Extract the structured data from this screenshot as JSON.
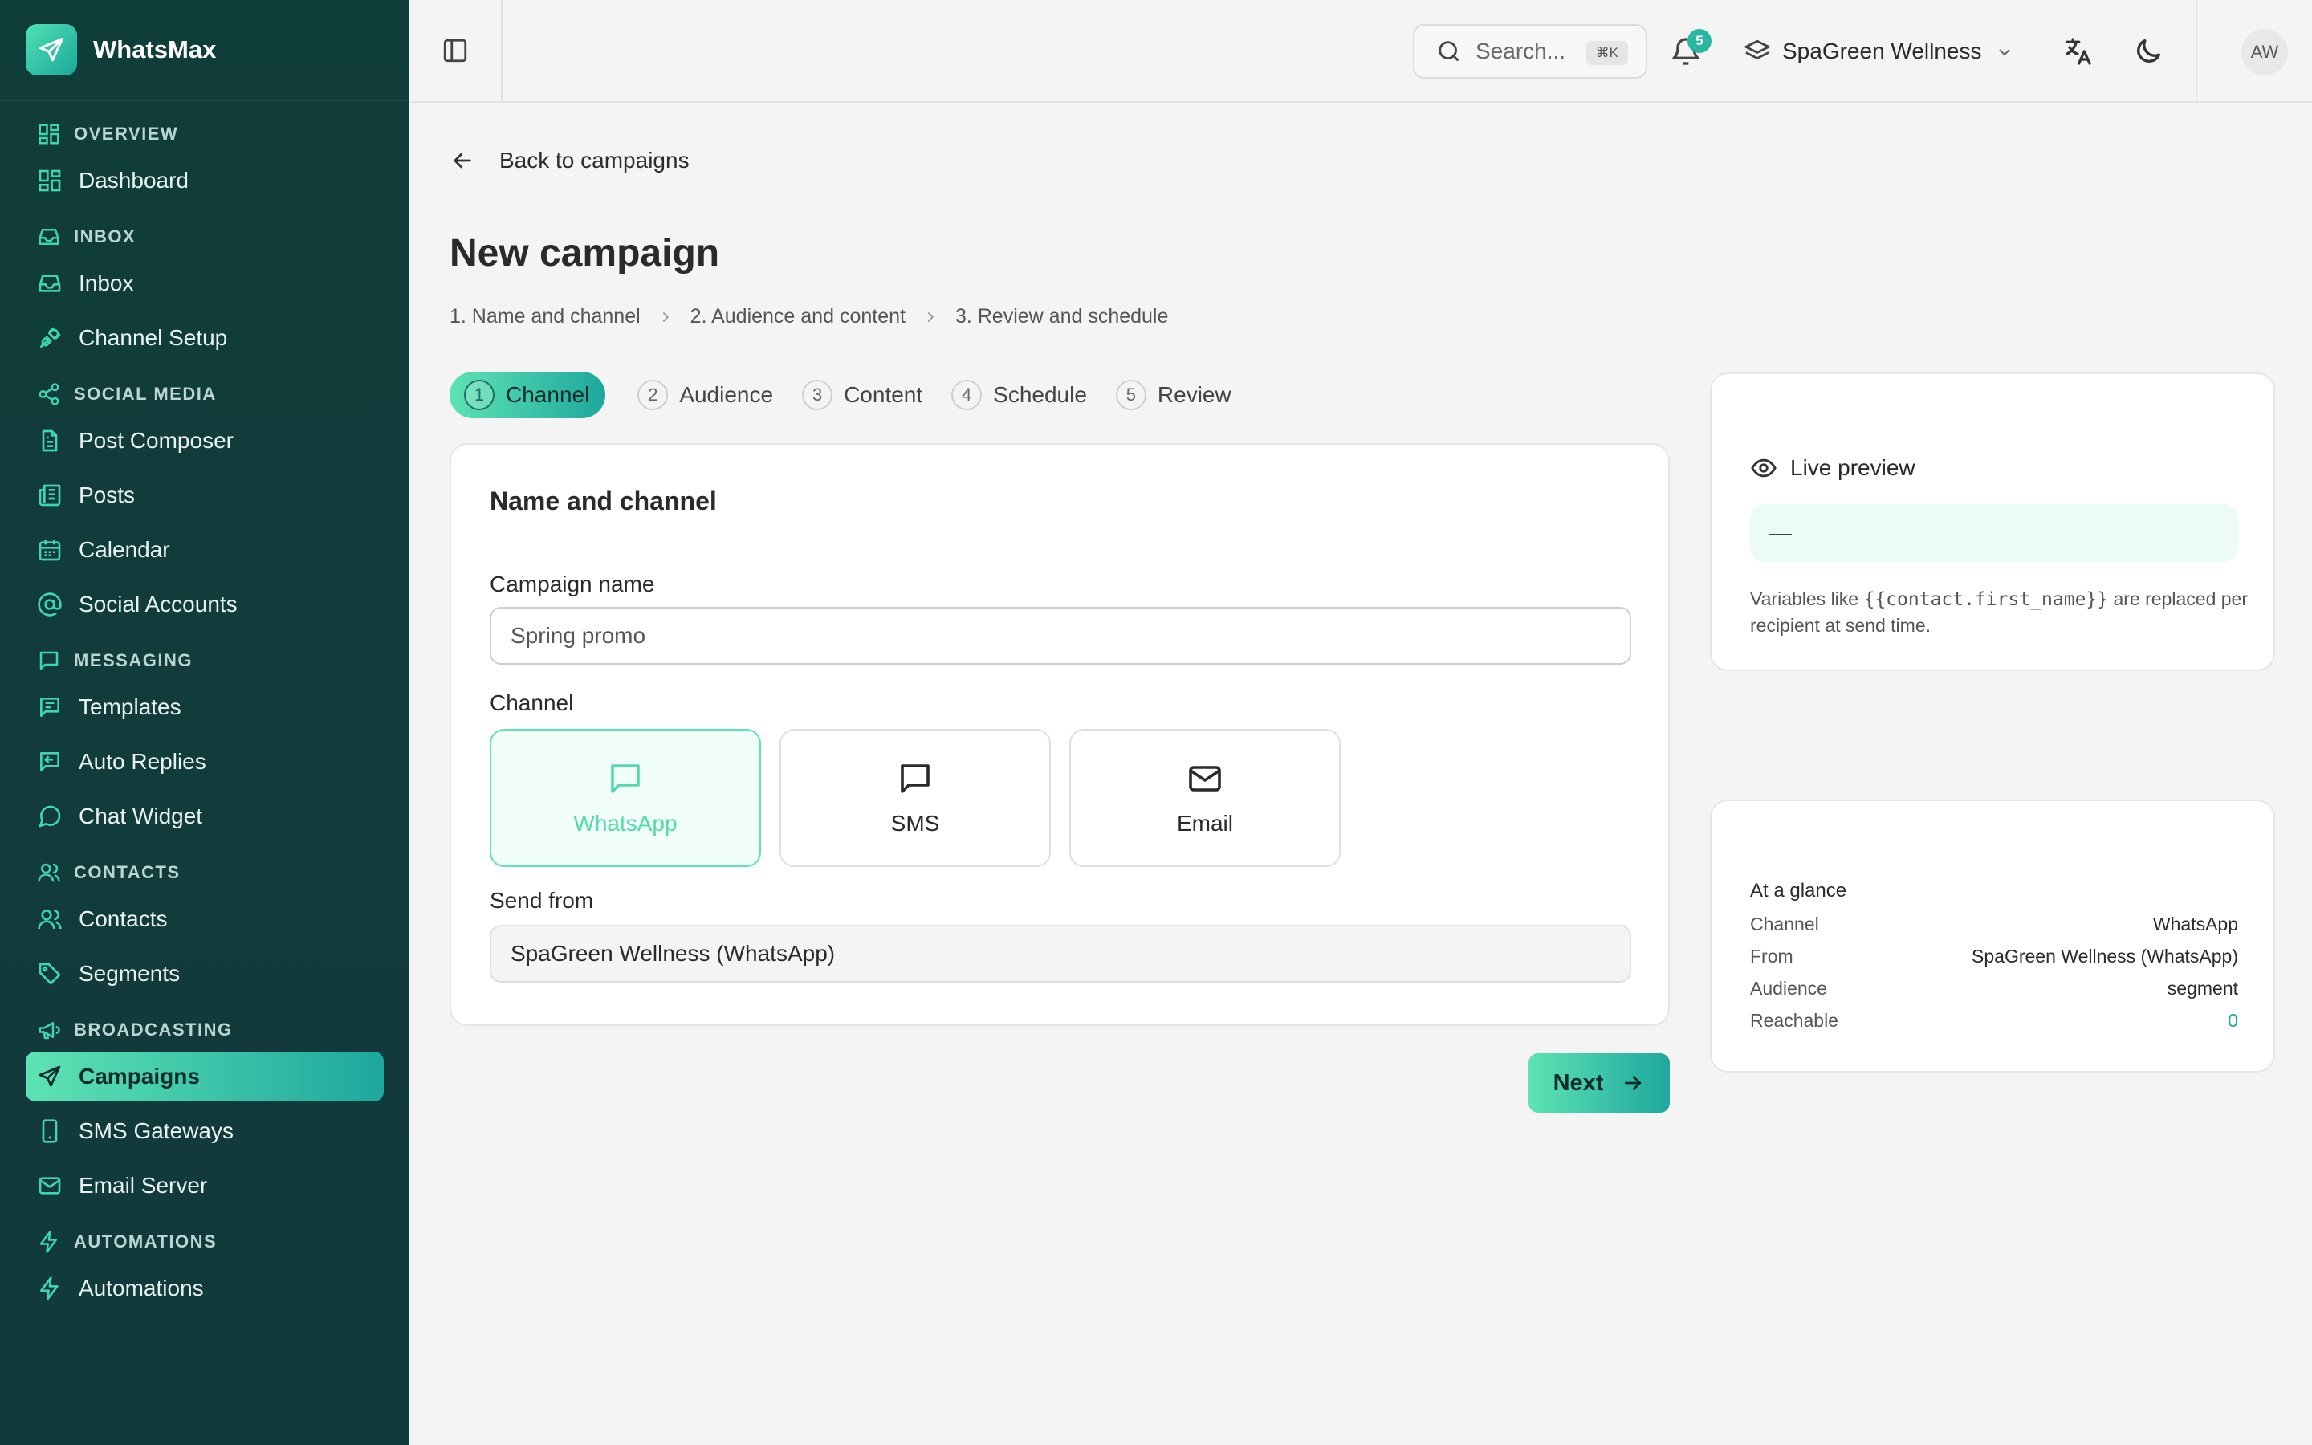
{
  "app": {
    "name": "WhatsMax"
  },
  "sidebar": {
    "sections": [
      {
        "title": "OVERVIEW",
        "items": [
          {
            "label": "Dashboard"
          }
        ]
      },
      {
        "title": "INBOX",
        "items": [
          {
            "label": "Inbox"
          },
          {
            "label": "Channel Setup"
          }
        ]
      },
      {
        "title": "SOCIAL MEDIA",
        "items": [
          {
            "label": "Post Composer"
          },
          {
            "label": "Posts"
          },
          {
            "label": "Calendar"
          },
          {
            "label": "Social Accounts"
          }
        ]
      },
      {
        "title": "MESSAGING",
        "items": [
          {
            "label": "Templates"
          },
          {
            "label": "Auto Replies"
          },
          {
            "label": "Chat Widget"
          }
        ]
      },
      {
        "title": "CONTACTS",
        "items": [
          {
            "label": "Contacts"
          },
          {
            "label": "Segments"
          }
        ]
      },
      {
        "title": "BROADCASTING",
        "items": [
          {
            "label": "Campaigns"
          },
          {
            "label": "SMS Gateways"
          },
          {
            "label": "Email Server"
          }
        ]
      },
      {
        "title": "AUTOMATIONS",
        "items": [
          {
            "label": "Automations"
          }
        ]
      }
    ],
    "active_item": "Campaigns"
  },
  "topbar": {
    "search_placeholder": "Search...",
    "search_shortcut": "⌘K",
    "notification_count": "5",
    "workspace": "SpaGreen Wellness",
    "avatar_initials": "AW"
  },
  "page": {
    "back_label": "Back to campaigns",
    "title": "New campaign",
    "breadcrumbs": [
      "1.  Name and channel",
      "2.  Audience and content",
      "3.  Review and schedule"
    ],
    "steps": [
      {
        "num": "1",
        "label": "Channel"
      },
      {
        "num": "2",
        "label": "Audience"
      },
      {
        "num": "3",
        "label": "Content"
      },
      {
        "num": "4",
        "label": "Schedule"
      },
      {
        "num": "5",
        "label": "Review"
      }
    ],
    "active_step": 1
  },
  "form": {
    "heading": "Name and channel",
    "campaign_name_label": "Campaign name",
    "campaign_name_placeholder": "Spring promo",
    "channel_label": "Channel",
    "channels": [
      {
        "label": "WhatsApp",
        "icon": "chat-bubble-icon"
      },
      {
        "label": "SMS",
        "icon": "message-square-icon"
      },
      {
        "label": "Email",
        "icon": "mail-icon"
      }
    ],
    "selected_channel": "WhatsApp",
    "send_from_label": "Send from",
    "send_from_value": "SpaGreen Wellness (WhatsApp)",
    "next_label": "Next"
  },
  "preview": {
    "title": "Live preview",
    "bubble_text": "—",
    "note_prefix": "Variables like ",
    "note_code": "{{contact.first_name}}",
    "note_suffix": " are replaced per recipient at send time."
  },
  "glance": {
    "title": "At a glance",
    "rows": [
      {
        "key": "Channel",
        "value": "WhatsApp"
      },
      {
        "key": "From",
        "value": "SpaGreen Wellness (WhatsApp)"
      },
      {
        "key": "Audience",
        "value": "segment"
      },
      {
        "key": "Reachable",
        "value": "0"
      }
    ]
  },
  "colors": {
    "sidebar_bg": "#0f3d3a",
    "accent_start": "#5ee3b3",
    "accent_end": "#1ea79e",
    "page_bg": "#f4f4f4"
  }
}
